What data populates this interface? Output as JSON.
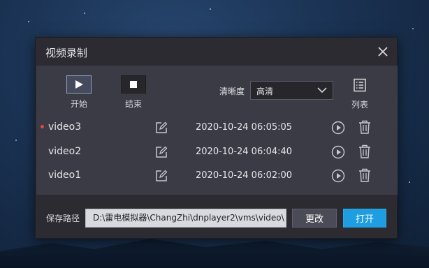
{
  "dialog": {
    "title": "视频录制",
    "close_icon": "close-icon"
  },
  "toolbar": {
    "start_label": "开始",
    "stop_label": "结束",
    "quality_label": "清晰度",
    "quality_value": "高清",
    "list_label": "列表"
  },
  "recordings": [
    {
      "name": "video3",
      "time": "2020-10-24 06:05:05",
      "active": true
    },
    {
      "name": "video2",
      "time": "2020-10-24 06:04:40",
      "active": false
    },
    {
      "name": "video1",
      "time": "2020-10-24 06:02:00",
      "active": false
    }
  ],
  "footer": {
    "path_label": "保存路径",
    "path_value": "D:\\雷电模拟器\\ChangZhi\\dnplayer2\\vms\\video\\",
    "change_label": "更改",
    "open_label": "打开"
  },
  "colors": {
    "accent": "#1e9ee0",
    "record_dot": "#e8453c",
    "panel": "#3a3b45",
    "dialog": "#2b2b31"
  }
}
